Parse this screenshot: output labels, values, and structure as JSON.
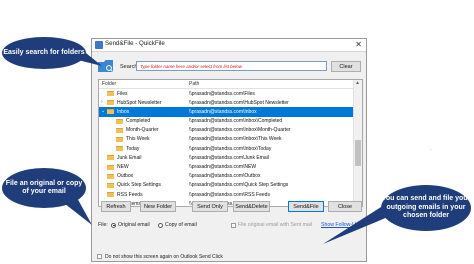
{
  "window": {
    "title": "Send&File - QuickFile",
    "close_glyph": "✕"
  },
  "search": {
    "label": "Search:",
    "placeholder": "Type folder name here and/or select from list below",
    "value": "",
    "clear_label": "Clear"
  },
  "list": {
    "header_folder": "Folder",
    "header_path": "Path",
    "rows": [
      {
        "name": "Files",
        "path": "\\\\prasadn@standss.com\\Files",
        "depth": 0,
        "arrow": "",
        "selected": false
      },
      {
        "name": "HubSpot Newsletter",
        "path": "\\\\prasadn@standss.com\\HubSpot Newsletter",
        "depth": 0,
        "arrow": ">",
        "selected": false
      },
      {
        "name": "Inbox",
        "path": "\\\\prasadn@standss.com\\Inbox",
        "depth": 0,
        "arrow": "v",
        "selected": true
      },
      {
        "name": "Completed",
        "path": "\\\\prasadn@standss.com\\Inbox\\Completed",
        "depth": 1,
        "arrow": "",
        "selected": false
      },
      {
        "name": "Month-Quarter",
        "path": "\\\\prasadn@standss.com\\Inbox\\Month-Quarter",
        "depth": 1,
        "arrow": "",
        "selected": false
      },
      {
        "name": "This Week",
        "path": "\\\\prasadn@standss.com\\Inbox\\This Week",
        "depth": 1,
        "arrow": "",
        "selected": false
      },
      {
        "name": "Today",
        "path": "\\\\prasadn@standss.com\\Inbox\\Today",
        "depth": 1,
        "arrow": "",
        "selected": false
      },
      {
        "name": "Junk Email",
        "path": "\\\\prasadn@standss.com\\Junk Email",
        "depth": 0,
        "arrow": "",
        "selected": false
      },
      {
        "name": "NEW",
        "path": "\\\\prasadn@standss.com\\NEW",
        "depth": 0,
        "arrow": "",
        "selected": false
      },
      {
        "name": "Outbox",
        "path": "\\\\prasadn@standss.com\\Outbox",
        "depth": 0,
        "arrow": "",
        "selected": false
      },
      {
        "name": "Quick Step Settings",
        "path": "\\\\prasadn@standss.com\\Quick Step Settings",
        "depth": 0,
        "arrow": "",
        "selected": false
      },
      {
        "name": "RSS Feeds",
        "path": "\\\\prasadn@standss.com\\RSS Feeds",
        "depth": 0,
        "arrow": "",
        "selected": false
      },
      {
        "name": "Sent Items",
        "path": "\\\\prasadn@standss.com\\Sent Items",
        "depth": 0,
        "arrow": "",
        "selected": false
      }
    ]
  },
  "file_options": {
    "label": "File:",
    "original_email": "Original email",
    "copy_of_email": "Copy of email",
    "file_original_with_sent": "File original email with Sent mail",
    "show_follow_up": "Show Follow-Up"
  },
  "buttons": {
    "refresh": "Refresh",
    "new_folder": "New Folder",
    "send_only": "Send Only",
    "send_delete": "Send&Delete",
    "send_file": "Send&File",
    "close": "Close"
  },
  "dont_show": "Do not show this screen again on Outlook Send Click",
  "callouts": {
    "search": "Easily search for folders",
    "file_copy": "File an original or copy of your email",
    "send_file": "You can send and file your outgoing emails in your chosen folder"
  },
  "colors": {
    "callout_bg": "#1f3d7a",
    "selection": "#0078d7",
    "warning_text": "#d02020"
  },
  "stray_mark": "·"
}
